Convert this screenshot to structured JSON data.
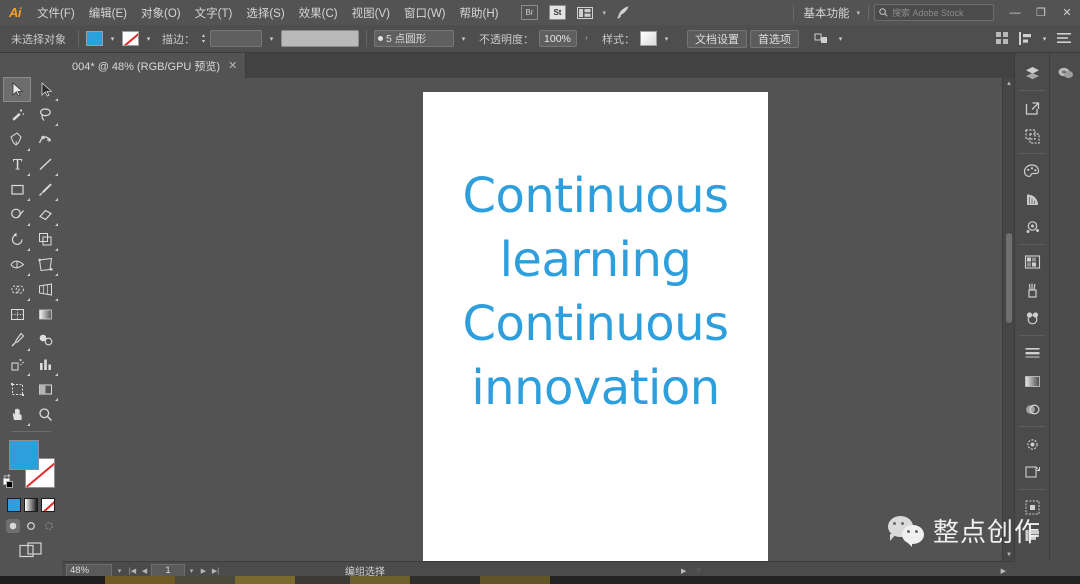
{
  "app": {
    "name": "Adobe Illustrator",
    "logo_text": "Ai"
  },
  "theme": {
    "accent_blue": "#2e9fdd",
    "menubar_bg": "#535353",
    "panel_bg": "#4b4b4b",
    "canvas_bg": "#535353",
    "artboard_bg": "#ffffff",
    "text_color": "#d6d6d6",
    "stroke_none_red": "#e02a28"
  },
  "menubar": {
    "items": [
      {
        "label": "文件(F)",
        "name": "menu-file"
      },
      {
        "label": "编辑(E)",
        "name": "menu-edit"
      },
      {
        "label": "对象(O)",
        "name": "menu-object"
      },
      {
        "label": "文字(T)",
        "name": "menu-type"
      },
      {
        "label": "选择(S)",
        "name": "menu-select"
      },
      {
        "label": "效果(C)",
        "name": "menu-effect"
      },
      {
        "label": "视图(V)",
        "name": "menu-view"
      },
      {
        "label": "窗口(W)",
        "name": "menu-window"
      },
      {
        "label": "帮助(H)",
        "name": "menu-help"
      }
    ],
    "bridge_label": "Br",
    "stock_label": "St",
    "arrange_label": "",
    "workspace": "基本功能",
    "search_placeholder": "搜索 Adobe Stock",
    "window_buttons": {
      "minimize": "—",
      "restore": "❐",
      "close": "✕"
    }
  },
  "controlbar": {
    "selection_status": "未选择对象",
    "fill_color": "#2e9fdd",
    "stroke_label": "描边：",
    "stroke_weight": "",
    "stroke_profile": "5 点圆形",
    "opacity_label": "不透明度：",
    "opacity_value": "100%",
    "style_label": "样式：",
    "doc_setup_button": "文档设置",
    "preferences_button": "首选项"
  },
  "tabbar": {
    "tabs": [
      {
        "title": "004* @ 48% (RGB/GPU 预览)",
        "close": "✕",
        "active": true
      }
    ]
  },
  "toolbar": {
    "tools": [
      {
        "name": "selection-tool",
        "label": "选择工具",
        "active": true
      },
      {
        "name": "direct-selection-tool",
        "label": "直接选择工具",
        "active": false
      },
      {
        "name": "magic-wand-tool",
        "label": "魔棒工具",
        "active": false
      },
      {
        "name": "lasso-tool",
        "label": "套索工具",
        "active": false
      },
      {
        "name": "pen-tool",
        "label": "钢笔工具",
        "active": false
      },
      {
        "name": "curvature-tool",
        "label": "曲率工具",
        "active": false
      },
      {
        "name": "type-tool",
        "label": "文字工具",
        "active": false
      },
      {
        "name": "line-segment-tool",
        "label": "直线段工具",
        "active": false
      },
      {
        "name": "rectangle-tool",
        "label": "矩形工具",
        "active": false
      },
      {
        "name": "paintbrush-tool",
        "label": "画笔工具",
        "active": false
      },
      {
        "name": "shaper-tool",
        "label": "Shaper 工具",
        "active": false
      },
      {
        "name": "eraser-tool",
        "label": "橡皮擦工具",
        "active": false
      },
      {
        "name": "rotate-tool",
        "label": "旋转工具",
        "active": false
      },
      {
        "name": "scale-tool",
        "label": "比例缩放工具",
        "active": false
      },
      {
        "name": "width-tool",
        "label": "宽度工具",
        "active": false
      },
      {
        "name": "free-transform-tool",
        "label": "自由变换工具",
        "active": false
      },
      {
        "name": "shape-builder-tool",
        "label": "形状生成器工具",
        "active": false
      },
      {
        "name": "perspective-grid-tool",
        "label": "透视网格工具",
        "active": false
      },
      {
        "name": "mesh-tool",
        "label": "网格工具",
        "active": false
      },
      {
        "name": "gradient-tool",
        "label": "渐变工具",
        "active": false
      },
      {
        "name": "eyedropper-tool",
        "label": "吸管工具",
        "active": false
      },
      {
        "name": "blend-tool",
        "label": "混合工具",
        "active": false
      },
      {
        "name": "symbol-sprayer-tool",
        "label": "符号喷枪工具",
        "active": false
      },
      {
        "name": "column-graph-tool",
        "label": "柱形图工具",
        "active": false
      },
      {
        "name": "artboard-tool",
        "label": "画板工具",
        "active": false
      },
      {
        "name": "slice-tool",
        "label": "切片工具",
        "active": false
      },
      {
        "name": "hand-tool",
        "label": "抓手工具",
        "active": false
      },
      {
        "name": "zoom-tool",
        "label": "缩放工具",
        "active": false
      }
    ],
    "fill_color": "#2e9fdd",
    "stroke_color": "none",
    "swap_icon": "⇄",
    "fill_modes": [
      {
        "name": "color-mode",
        "label": "颜色"
      },
      {
        "name": "gradient-mode",
        "label": "渐变"
      },
      {
        "name": "none-mode",
        "label": "无"
      }
    ],
    "draw_modes": [
      {
        "name": "draw-normal-mode",
        "label": "正常绘图",
        "selected": true
      },
      {
        "name": "draw-behind-mode",
        "label": "背面绘图",
        "selected": false
      },
      {
        "name": "draw-inside-mode",
        "label": "内部绘图",
        "selected": false
      }
    ],
    "screen_mode": "更改屏幕模式"
  },
  "canvas": {
    "zoom": "48%",
    "artwork_text_lines": [
      "Continuous",
      "learning",
      "Continuous",
      "innovation"
    ],
    "artwork_text_color": "#2e9fdd"
  },
  "dock": {
    "left_icons": [
      {
        "name": "layers-panel-icon",
        "label": "图层"
      },
      {
        "name": "libraries-panel-icon",
        "label": "库"
      },
      {
        "name": "artboards-panel-icon",
        "label": "画板"
      },
      {
        "name": "color-panel-icon",
        "label": "颜色"
      },
      {
        "name": "color-guide-panel-icon",
        "label": "颜色参考"
      },
      {
        "name": "symbols-panel-icon",
        "label": "符号"
      },
      {
        "name": "swatches-panel-icon",
        "label": "色板"
      },
      {
        "name": "brushes-panel-icon",
        "label": "画笔"
      },
      {
        "name": "graphic-styles-panel-icon",
        "label": "图形样式"
      },
      {
        "name": "stroke-panel-icon",
        "label": "描边"
      },
      {
        "name": "gradient-panel-icon",
        "label": "渐变"
      },
      {
        "name": "transparency-panel-icon",
        "label": "透明度"
      },
      {
        "name": "appearance-panel-icon",
        "label": "外观"
      },
      {
        "name": "transform-panel-icon",
        "label": "变换"
      },
      {
        "name": "align-panel-icon",
        "label": "对齐"
      },
      {
        "name": "pathfinder-panel-icon",
        "label": "路径查找器"
      }
    ],
    "right_icons": [
      {
        "name": "properties-panel-icon",
        "label": "属性"
      }
    ]
  },
  "statusbar": {
    "zoom_value": "48%",
    "artboard_number": "1",
    "status_text": "编组选择",
    "nav_first": "|◀",
    "nav_prev": "◀",
    "nav_next": "▶",
    "nav_last": "▶|"
  },
  "watermark": {
    "text": "整点创作",
    "logo": "wechat-icon"
  }
}
